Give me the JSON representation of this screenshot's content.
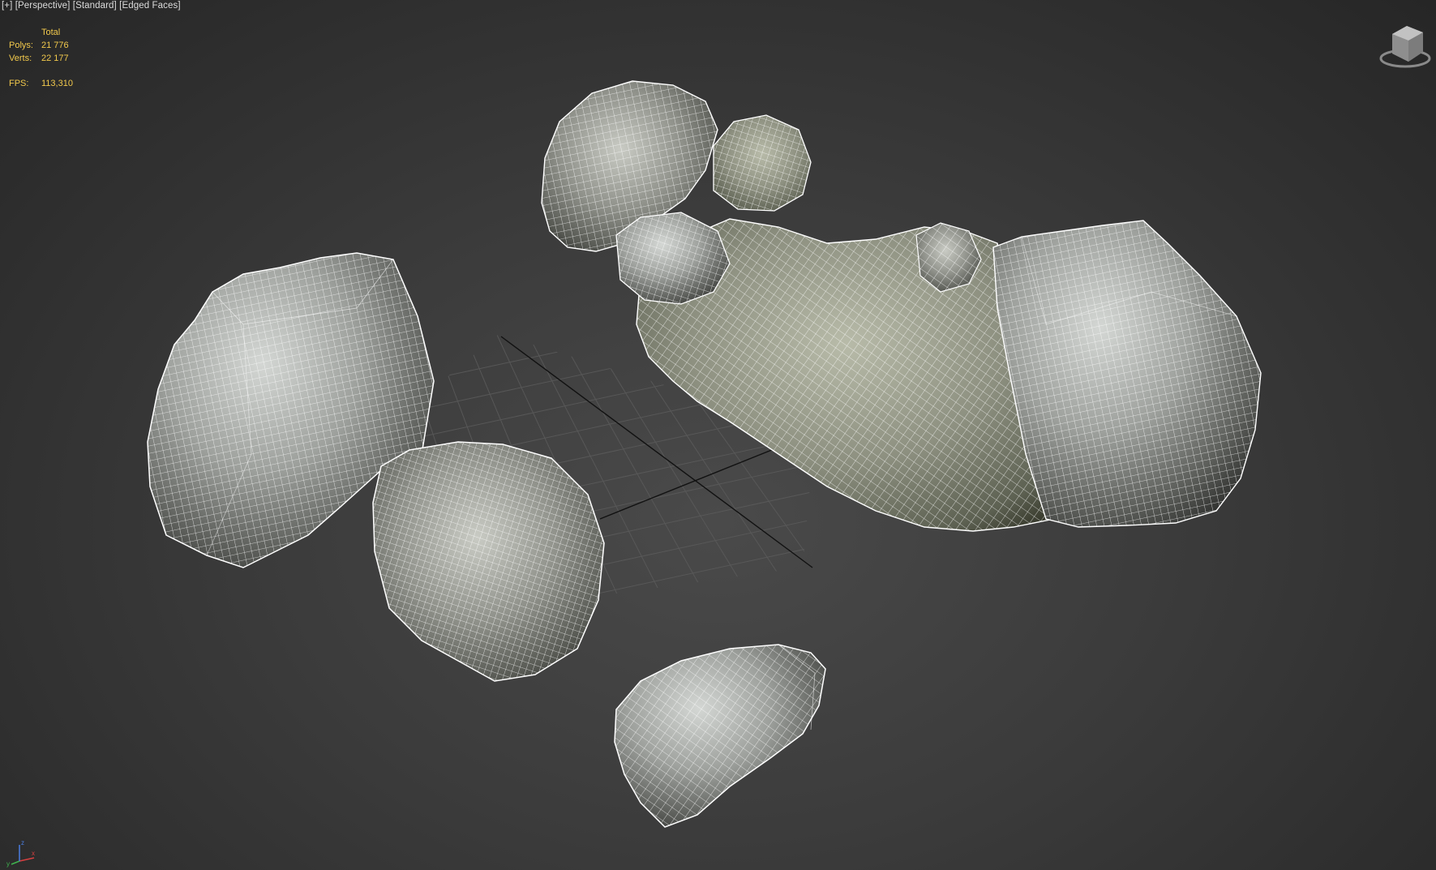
{
  "viewport": {
    "menu": {
      "plus": "[+]",
      "view": "[Perspective]",
      "shading": "[Standard]",
      "display": "[Edged Faces]"
    },
    "stats": {
      "header": "Total",
      "polys_label": "Polys:",
      "polys_value": "21 776",
      "verts_label": "Verts:",
      "verts_value": "22 177",
      "fps_label": "FPS:",
      "fps_value": "113,310"
    },
    "axis_tripod": {
      "x": "x",
      "y": "y",
      "z": "z"
    },
    "colors": {
      "background": "#3b3b3b",
      "stats_text": "#f2c94c",
      "wireframe": "#ffffff",
      "grid": "#5a5a5a",
      "grid_center": "#101010"
    },
    "objects": [
      "rock-left-large",
      "rock-left-small",
      "rock-front",
      "rock-cluster-back"
    ],
    "icons": [
      "viewcube-icon",
      "axis-tripod-icon"
    ]
  }
}
